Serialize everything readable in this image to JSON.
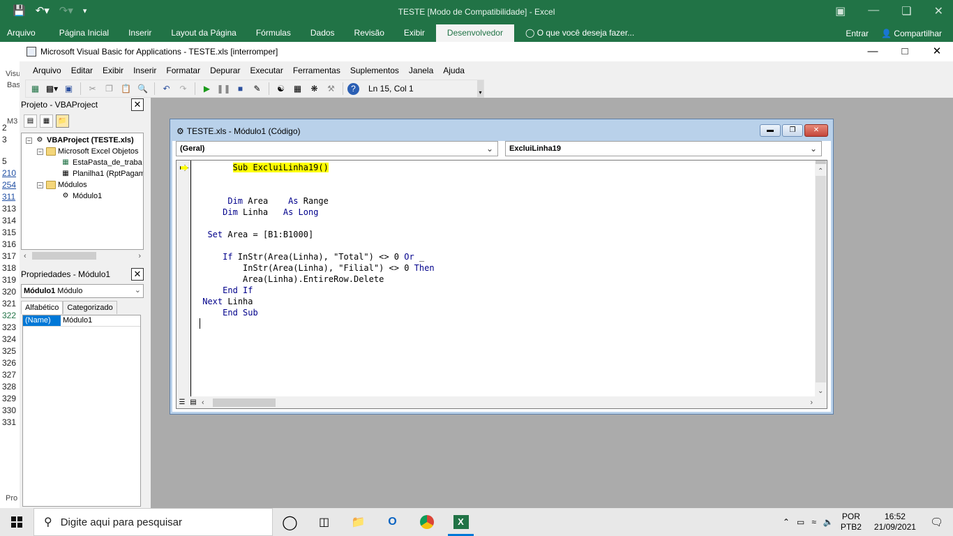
{
  "excel": {
    "title": "TESTE  [Modo de Compatibilidade] - Excel",
    "tabs": [
      "Arquivo",
      "Página Inicial",
      "Inserir",
      "Layout da Página",
      "Fórmulas",
      "Dados",
      "Revisão",
      "Exibir",
      "Desenvolvedor"
    ],
    "tell_me": "O que você deseja fazer...",
    "signin": "Entrar",
    "share": "Compartilhar",
    "left_fragments": {
      "a": "Visu",
      "b": "Bas",
      "c": "M3",
      "d": "Pro"
    },
    "row_numbers": [
      {
        "n": "2",
        "style": "normal"
      },
      {
        "n": "3",
        "style": "normal"
      },
      {
        "n": "5",
        "style": "normal"
      },
      {
        "n": "210",
        "style": "blue"
      },
      {
        "n": "254",
        "style": "blue"
      },
      {
        "n": "311",
        "style": "blue"
      },
      {
        "n": "313",
        "style": "normal"
      },
      {
        "n": "314",
        "style": "normal"
      },
      {
        "n": "315",
        "style": "normal"
      },
      {
        "n": "316",
        "style": "normal"
      },
      {
        "n": "317",
        "style": "normal"
      },
      {
        "n": "318",
        "style": "normal"
      },
      {
        "n": "319",
        "style": "normal"
      },
      {
        "n": "320",
        "style": "normal"
      },
      {
        "n": "321",
        "style": "normal"
      },
      {
        "n": "322",
        "style": "sel"
      },
      {
        "n": "323",
        "style": "normal"
      },
      {
        "n": "324",
        "style": "normal"
      },
      {
        "n": "325",
        "style": "normal"
      },
      {
        "n": "326",
        "style": "normal"
      },
      {
        "n": "327",
        "style": "normal"
      },
      {
        "n": "328",
        "style": "normal"
      },
      {
        "n": "329",
        "style": "normal"
      },
      {
        "n": "330",
        "style": "normal"
      },
      {
        "n": "331",
        "style": "normal"
      }
    ]
  },
  "vbe": {
    "title": "Microsoft Visual Basic for Applications - TESTE.xls [interromper]",
    "menu": [
      "Arquivo",
      "Editar",
      "Exibir",
      "Inserir",
      "Formatar",
      "Depurar",
      "Executar",
      "Ferramentas",
      "Suplementos",
      "Janela",
      "Ajuda"
    ],
    "status_position": "Ln 15, Col 1"
  },
  "project": {
    "title": "Projeto - VBAProject",
    "root": "VBAProject (TESTE.xls)",
    "folder_objects": "Microsoft Excel Objetos",
    "item_workbook": "EstaPasta_de_traba",
    "item_sheet": "Planilha1 (RptPagam",
    "folder_modules": "Módulos",
    "item_module": "Módulo1"
  },
  "properties": {
    "title": "Propriedades - Módulo1",
    "object_name": "Módulo1",
    "object_type": "Módulo",
    "tab_alpha": "Alfabético",
    "tab_cat": "Categorizado",
    "rows": [
      {
        "key": "(Name)",
        "value": "Módulo1"
      }
    ]
  },
  "code_window": {
    "title": "TESTE.xls - Módulo1 (Código)",
    "object_combo": "(Geral)",
    "proc_combo": "ExcluiLinha19",
    "lines": [
      {
        "pre": "       ",
        "tokens": [
          {
            "t": "Sub ExcluiLinha19()",
            "c": "hl"
          }
        ]
      },
      {
        "pre": "",
        "tokens": []
      },
      {
        "pre": "",
        "tokens": []
      },
      {
        "pre": "      ",
        "tokens": [
          {
            "t": "Dim",
            "c": "kw"
          },
          {
            "t": " Area    ",
            "c": ""
          },
          {
            "t": "As",
            "c": "kw"
          },
          {
            "t": " Range",
            "c": ""
          }
        ]
      },
      {
        "pre": "     ",
        "tokens": [
          {
            "t": "Dim",
            "c": "kw"
          },
          {
            "t": " Linha   ",
            "c": ""
          },
          {
            "t": "As Long",
            "c": "kw"
          }
        ]
      },
      {
        "pre": "",
        "tokens": []
      },
      {
        "pre": "  ",
        "tokens": [
          {
            "t": "Set",
            "c": "kw"
          },
          {
            "t": " Area = [B1:B1000]",
            "c": ""
          }
        ]
      },
      {
        "pre": "",
        "tokens": []
      },
      {
        "pre": "     ",
        "tokens": [
          {
            "t": "If",
            "c": "kw"
          },
          {
            "t": " InStr(Area(Linha), \"Total\") <> 0 ",
            "c": ""
          },
          {
            "t": "Or",
            "c": "kw"
          },
          {
            "t": " _",
            "c": ""
          }
        ]
      },
      {
        "pre": "         ",
        "tokens": [
          {
            "t": "InStr(Area(Linha), \"Filial\") <> 0 ",
            "c": ""
          },
          {
            "t": "Then",
            "c": "kw"
          }
        ]
      },
      {
        "pre": "         ",
        "tokens": [
          {
            "t": "Area(Linha).EntireRow.Delete",
            "c": ""
          }
        ]
      },
      {
        "pre": "     ",
        "tokens": [
          {
            "t": "End If",
            "c": "kw"
          }
        ]
      },
      {
        "pre": " ",
        "tokens": [
          {
            "t": "Next",
            "c": "kw"
          },
          {
            "t": " Linha",
            "c": ""
          }
        ]
      },
      {
        "pre": "     ",
        "tokens": [
          {
            "t": "End Sub",
            "c": "kw"
          }
        ]
      }
    ]
  },
  "taskbar": {
    "search_placeholder": "Digite aqui para pesquisar",
    "lang_top": "POR",
    "lang_bottom": "PTB2",
    "time": "16:52",
    "date": "21/09/2021"
  }
}
